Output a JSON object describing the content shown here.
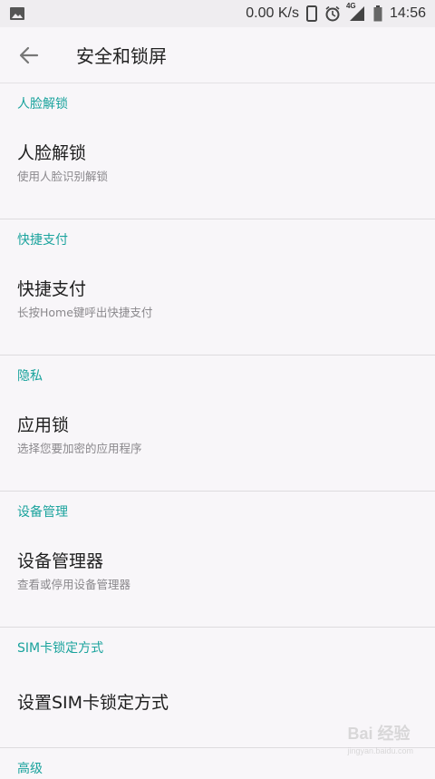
{
  "status_bar": {
    "net_speed": "0.00 K/s",
    "network": "4G",
    "time": "14:56"
  },
  "app_bar": {
    "title": "安全和锁屏"
  },
  "sections": [
    {
      "header": "人脸解锁",
      "item_title": "人脸解锁",
      "item_sub": "使用人脸识别解锁"
    },
    {
      "header": "快捷支付",
      "item_title": "快捷支付",
      "item_sub": "长按Home键呼出快捷支付"
    },
    {
      "header": "隐私",
      "item_title": "应用锁",
      "item_sub": "选择您要加密的应用程序"
    },
    {
      "header": "设备管理",
      "item_title": "设备管理器",
      "item_sub": "查看或停用设备管理器"
    },
    {
      "header": "SIM卡锁定方式",
      "item_title": "设置SIM卡锁定方式"
    },
    {
      "header": "高级"
    }
  ],
  "watermark": {
    "brand": "Bai 经验",
    "url": "jingyan.baidu.com"
  }
}
